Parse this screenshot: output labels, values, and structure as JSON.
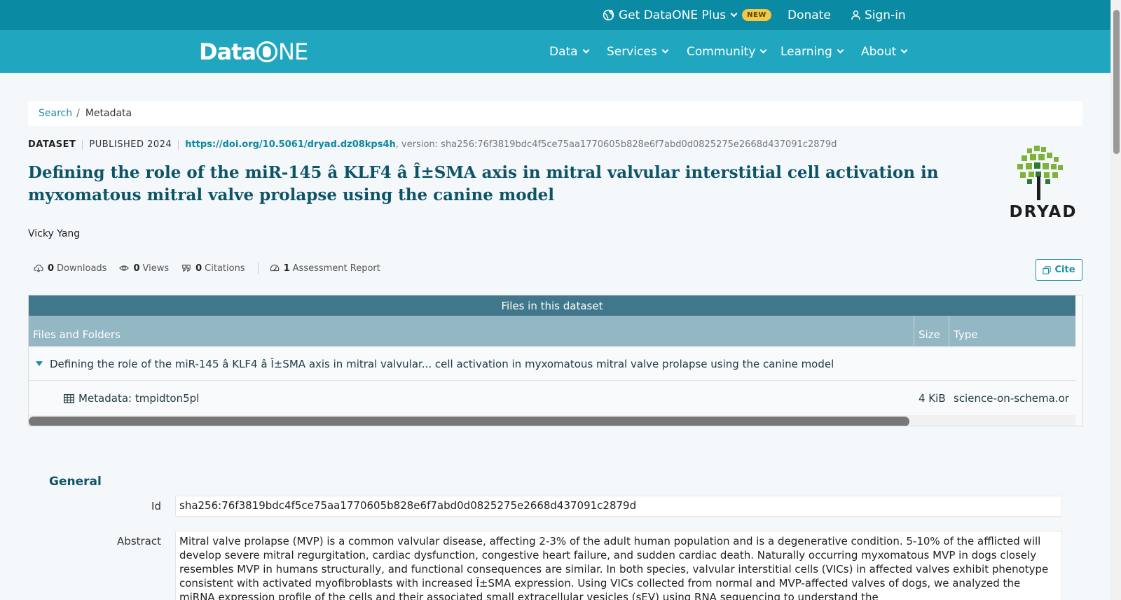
{
  "topbar": {
    "plus_label": "Get DataONE Plus",
    "new_badge": "NEW",
    "donate_label": "Donate",
    "signin_label": "Sign-in"
  },
  "nav": {
    "logo_text_a": "Data",
    "logo_text_b": "NE",
    "items": [
      "Data",
      "Services",
      "Community",
      "Learning",
      "About"
    ]
  },
  "breadcrumb": {
    "search": "Search",
    "separator": "/",
    "current": "Metadata"
  },
  "dataset": {
    "type_label": "DATASET",
    "published": "PUBLISHED 2024",
    "doi": "https://doi.org/10.5061/dryad.dz08kps4h",
    "version": ", version: sha256:76f3819bdc4f5ce75aa1770605b828e6f7abd0d0825275e2668d437091c2879d",
    "title": "Defining the role of the miR-145 â KLF4 â Î±SMA axis in mitral valvular interstitial cell activation in myxomatous mitral valve prolapse using the canine model",
    "author": "Vicky Yang",
    "repository_logo_word": "DRYAD"
  },
  "metrics": {
    "downloads_count": "0",
    "downloads_label": "Downloads",
    "views_count": "0",
    "views_label": "Views",
    "citations_count": "0",
    "citations_label": "Citations",
    "assessment_count": "1",
    "assessment_label": "Assessment Report",
    "cite_label": "Cite"
  },
  "files": {
    "caption": "Files in this dataset",
    "columns": [
      "Files and Folders",
      "Size",
      "Type"
    ],
    "folder_name": "Defining the role of the miR-145 â KLF4 â Î±SMA axis in mitral valvular... cell activation in myxomatous mitral valve prolapse using the canine model",
    "rows": [
      {
        "name": "Metadata: tmpidton5pl",
        "size": "4 KiB",
        "type": "science-on-schema.or"
      }
    ]
  },
  "general": {
    "title": "General",
    "id_label": "Id",
    "id_value": "sha256:76f3819bdc4f5ce75aa1770605b828e6f7abd0d0825275e2668d437091c2879d",
    "abstract_label": "Abstract",
    "abstract_value": "Mitral valve prolapse (MVP) is a common valvular disease, affecting 2-3% of the adult human population and is a degenerative condition. 5-10% of the afflicted will develop severe mitral regurgitation, cardiac dysfunction, congestive heart failure, and sudden cardiac death. Naturally occurring myxomatous MVP in dogs closely resembles MVP in humans structurally, and functional consequences are similar. In both species, valvular interstitial cells (VICs) in affected valves exhibit phenotype consistent with activated myofibroblasts with increased Î±SMA expression. Using VICs collected from normal and MVP-affected valves of dogs, we analyzed the miRNA expression profile of the cells and their associated small extracellular vesicles (sEV) using RNA sequencing to understand the"
  },
  "colors": {
    "topbar": "#0a8ba3",
    "navbar": "#20a7bf",
    "title": "#0e5468",
    "link": "#1a8ea8",
    "table_caption": "#41778a",
    "table_head": "#93b7c3"
  }
}
